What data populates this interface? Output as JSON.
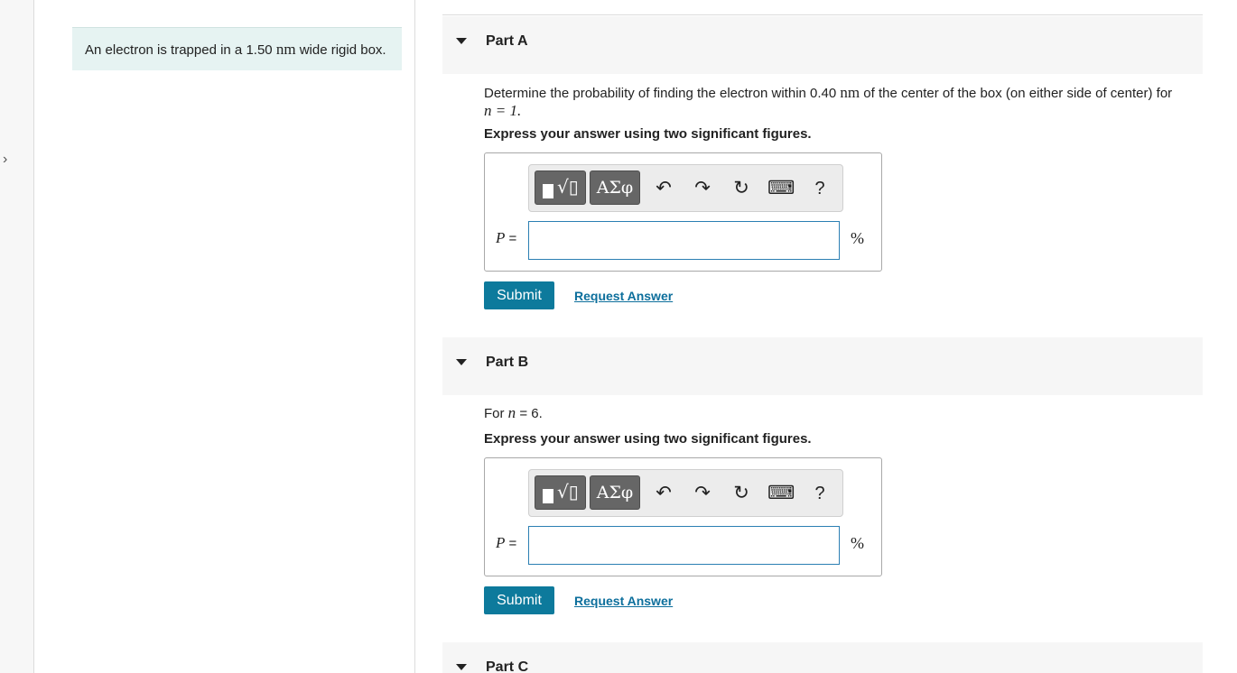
{
  "intro": {
    "text_before": "An electron is trapped in a 1.50 ",
    "unit": "nm",
    "text_after": " wide rigid box."
  },
  "toolbar": {
    "greek_label": "ΑΣφ",
    "undo_glyph": "↶",
    "redo_glyph": "↷",
    "reset_glyph": "↻",
    "keyboard_glyph": "⌨",
    "help_glyph": "?"
  },
  "partA": {
    "title": "Part A",
    "prompt_1": "Determine the probability of finding the electron within 0.40 ",
    "prompt_unit": "nm",
    "prompt_2": " of the center of the box (on either side of center) for",
    "prompt_math": "n = 1.",
    "instruction": "Express your answer using two significant figures.",
    "var_label": "P",
    "equals": " =",
    "input_value": "",
    "unit": "%",
    "submit_label": "Submit",
    "request_label": "Request Answer"
  },
  "partB": {
    "title": "Part B",
    "prompt_1": "For ",
    "prompt_var": "n",
    "prompt_2": " = 6.",
    "instruction": "Express your answer using two significant figures.",
    "var_label": "P",
    "equals": " =",
    "input_value": "",
    "unit": "%",
    "submit_label": "Submit",
    "request_label": "Request Answer"
  },
  "partC": {
    "title": "Part C"
  },
  "rail": {
    "toggle_glyph": "›"
  }
}
